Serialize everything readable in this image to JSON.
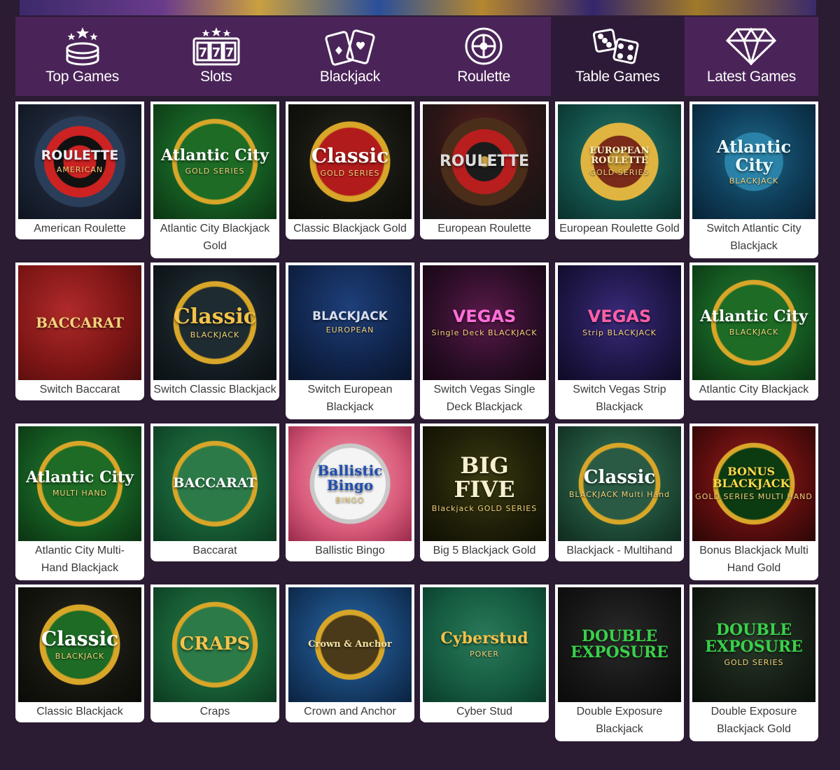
{
  "nav": {
    "items": [
      {
        "label": "Top Games",
        "icon": "poker-chips-stars-icon"
      },
      {
        "label": "Slots",
        "icon": "slot-machine-777-icon"
      },
      {
        "label": "Blackjack",
        "icon": "playing-cards-icon"
      },
      {
        "label": "Roulette",
        "icon": "roulette-wheel-icon"
      },
      {
        "label": "Table Games",
        "icon": "dice-icon"
      },
      {
        "label": "Latest Games",
        "icon": "diamond-icon"
      }
    ],
    "active_index": 4
  },
  "colors": {
    "page_bg": "#2b1b33",
    "nav_bg": "#4a2458",
    "nav_active_bg": "#2d1a38",
    "card_bg": "#ffffff",
    "card_text": "#3a3a3a"
  },
  "games": [
    {
      "name": "American Roulette",
      "art": "ROULETTE",
      "sub": "AMERICAN"
    },
    {
      "name": "Atlantic City Blackjack Gold",
      "art": "Atlantic City",
      "sub": "GOLD SERIES"
    },
    {
      "name": "Classic Blackjack Gold",
      "art": "Classic",
      "sub": "GOLD SERIES"
    },
    {
      "name": "European Roulette",
      "art": "ROULETTE",
      "sub": ""
    },
    {
      "name": "European Roulette Gold",
      "art": "EUROPEAN ROULETTE",
      "sub": "GOLD SERIES"
    },
    {
      "name": "Switch Atlantic City Blackjack",
      "art": "Atlantic City",
      "sub": "BLACKJACK"
    },
    {
      "name": "Switch Baccarat",
      "art": "BACCARAT",
      "sub": ""
    },
    {
      "name": "Switch Classic Blackjack",
      "art": "Classic",
      "sub": "BLACKJACK"
    },
    {
      "name": "Switch European Blackjack",
      "art": "BLACKJACK",
      "sub": "EUROPEAN"
    },
    {
      "name": "Switch Vegas Single Deck Blackjack",
      "art": "VEGAS",
      "sub": "Single Deck BLACKJACK"
    },
    {
      "name": "Switch Vegas Strip Blackjack",
      "art": "VEGAS",
      "sub": "Strip BLACKJACK"
    },
    {
      "name": "Atlantic City Blackjack",
      "art": "Atlantic City",
      "sub": "BLACKJACK"
    },
    {
      "name": "Atlantic City Multi-Hand Blackjack",
      "art": "Atlantic City",
      "sub": "MULTI HAND"
    },
    {
      "name": "Baccarat",
      "art": "BACCARAT",
      "sub": ""
    },
    {
      "name": "Ballistic Bingo",
      "art": "Ballistic Bingo",
      "sub": "BINGO"
    },
    {
      "name": "Big 5 Blackjack Gold",
      "art": "BIG FIVE",
      "sub": "Blackjack GOLD SERIES"
    },
    {
      "name": "Blackjack - Multihand",
      "art": "Classic",
      "sub": "BLACKJACK Multi Hand"
    },
    {
      "name": "Bonus Blackjack Multi Hand Gold",
      "art": "BONUS BLACKJACK",
      "sub": "GOLD SERIES MULTI HAND"
    },
    {
      "name": "Classic Blackjack",
      "art": "Classic",
      "sub": "BLACKJACK"
    },
    {
      "name": "Craps",
      "art": "CRAPS",
      "sub": ""
    },
    {
      "name": "Crown and Anchor",
      "art": "Crown & Anchor",
      "sub": ""
    },
    {
      "name": "Cyber Stud",
      "art": "Cyberstud",
      "sub": "POKER"
    },
    {
      "name": "Double Exposure Blackjack",
      "art": "DOUBLE EXPOSURE",
      "sub": ""
    },
    {
      "name": "Double Exposure Blackjack Gold",
      "art": "DOUBLE EXPOSURE",
      "sub": "GOLD SERIES"
    }
  ]
}
